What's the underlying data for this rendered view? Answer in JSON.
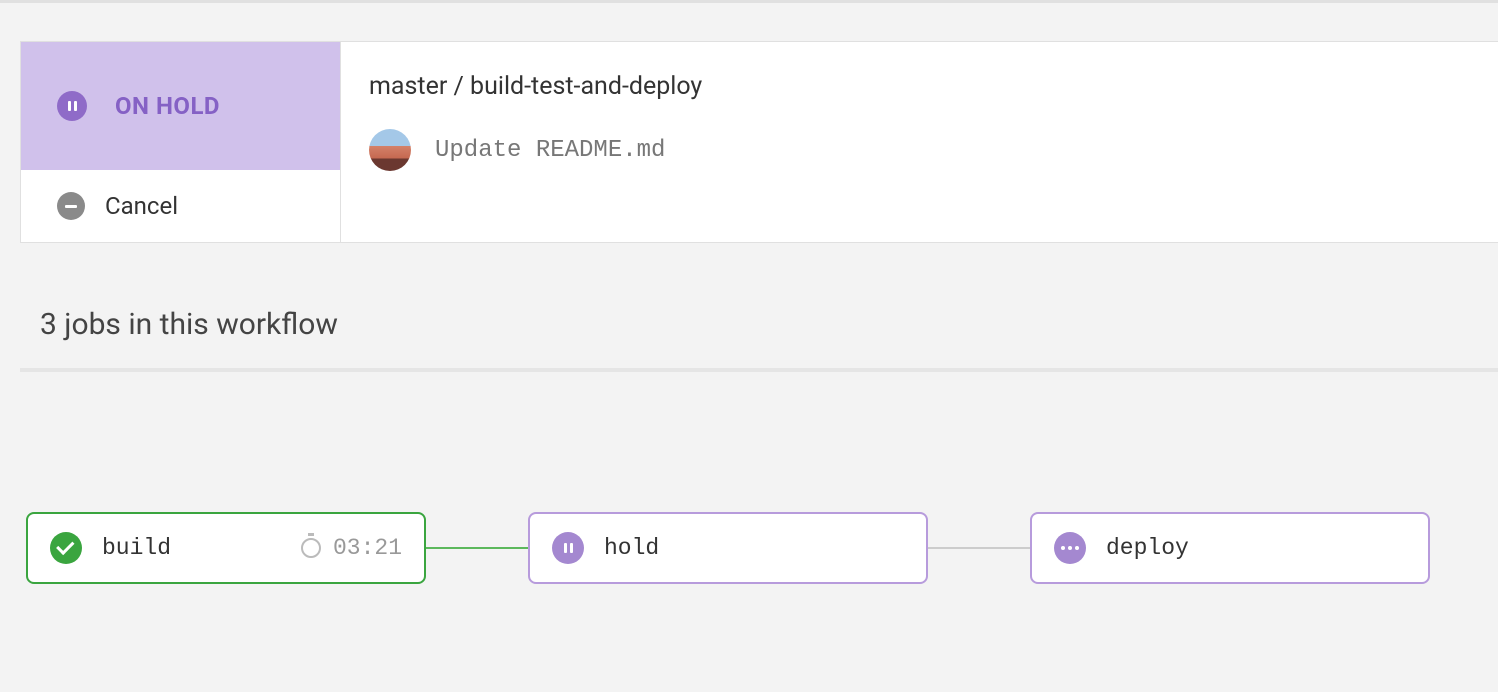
{
  "status": {
    "label": "ON HOLD",
    "cancel_label": "Cancel"
  },
  "header": {
    "breadcrumb": "master / build-test-and-deploy",
    "commit_message": "Update README.md"
  },
  "workflow": {
    "heading": "3 jobs in this workflow",
    "jobs": {
      "build": {
        "name": "build",
        "duration": "03:21"
      },
      "hold": {
        "name": "hold"
      },
      "deploy": {
        "name": "deploy"
      }
    }
  }
}
